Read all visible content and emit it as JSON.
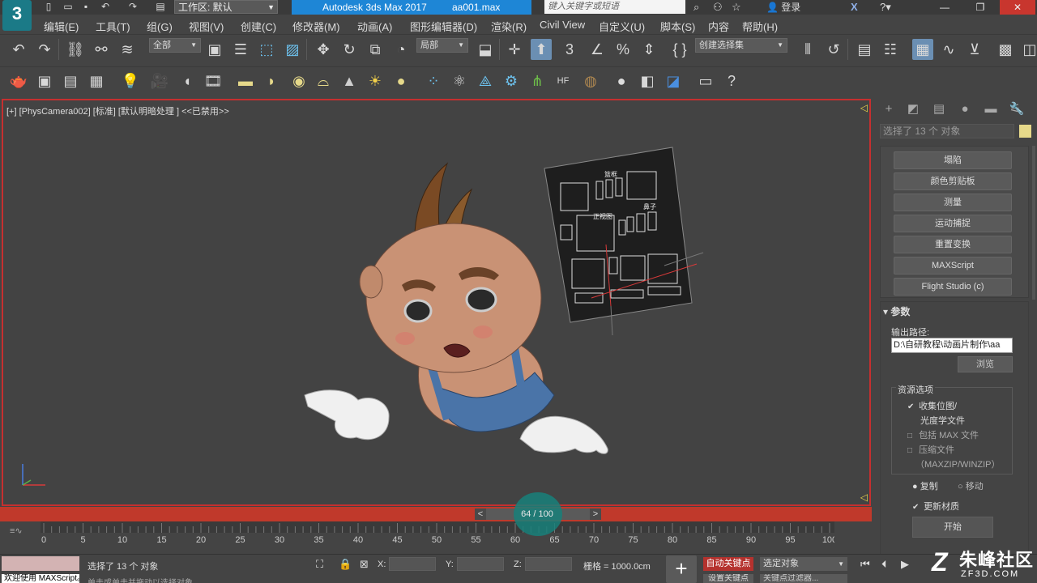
{
  "titlebar": {
    "workspace": "工作区: 默认",
    "app_name": "Autodesk 3ds Max 2017",
    "file_name": "aa001.max",
    "search_placeholder": "键入关键字或短语",
    "login": "登录",
    "logo_text": "3"
  },
  "menu": [
    "编辑(E)",
    "工具(T)",
    "组(G)",
    "视图(V)",
    "创建(C)",
    "修改器(M)",
    "动画(A)",
    "图形编辑器(D)",
    "渲染(R)",
    "Civil View",
    "自定义(U)",
    "脚本(S)",
    "内容",
    "帮助(H)"
  ],
  "toolbar": {
    "selection_filter": "全部",
    "ref_coord": "局部",
    "snap_value": "3",
    "named_selection_set": "创建选择集"
  },
  "viewport": {
    "label": "[+] [PhysCamera002] [标准] [默认明暗处理 ] <<已禁用>>",
    "blueprint_labels": [
      "篮框",
      "正视图",
      "鼻子"
    ]
  },
  "timeslider": {
    "current": "64 / 100",
    "prev": "<",
    "next": ">"
  },
  "trackbar": {
    "ticks": [
      "0",
      "5",
      "10",
      "15",
      "20",
      "25",
      "30",
      "35",
      "40",
      "45",
      "50",
      "55",
      "60",
      "65",
      "70",
      "75",
      "80",
      "85",
      "90",
      "95",
      "100"
    ]
  },
  "status": {
    "selection_info": "选择了 13 个 对象",
    "hint": "单击或单击并拖动以选择对象",
    "mini_listener": "欢迎使用 MAXScript。",
    "x_label": "X:",
    "y_label": "Y:",
    "z_label": "Z:",
    "grid": "栅格 = 1000.0cm",
    "auto_key": "自动关键点",
    "set_key": "设置关键点",
    "selected_objects": "选定对象",
    "key_filters": "关键点过滤器..."
  },
  "watermark": {
    "z_glyph": "Z",
    "title": "朱峰社区",
    "url": "ZF3D.COM"
  },
  "command_panel": {
    "selection_count": "选择了 13 个 对象",
    "utility_buttons": [
      "塌陷",
      "颜色剪贴板",
      "测量",
      "运动捕捉",
      "重置变换",
      "MAXScript",
      "Flight Studio (c)"
    ],
    "rollout_title": "参数",
    "output_path_label": "输出路径:",
    "output_path": "D:\\自研教程\\动画片制作\\aa",
    "browse": "浏览",
    "resources_label": "资源选项",
    "collect_bitmaps": "收集位图/",
    "photometric_files": "光度学文件",
    "include_max": "包括 MAX 文件",
    "compress": "压缩文件",
    "maxzip": "（MAXZIP/WINZIP）",
    "copy": "复制",
    "move": "移动",
    "update_materials": "更新材质",
    "start": "开始"
  },
  "colors": {
    "accent_blue": "#1e86d6",
    "viewport_border": "#c62f2f",
    "autokey_red": "#b5322e",
    "selection_yellow": "#e6d98a"
  }
}
